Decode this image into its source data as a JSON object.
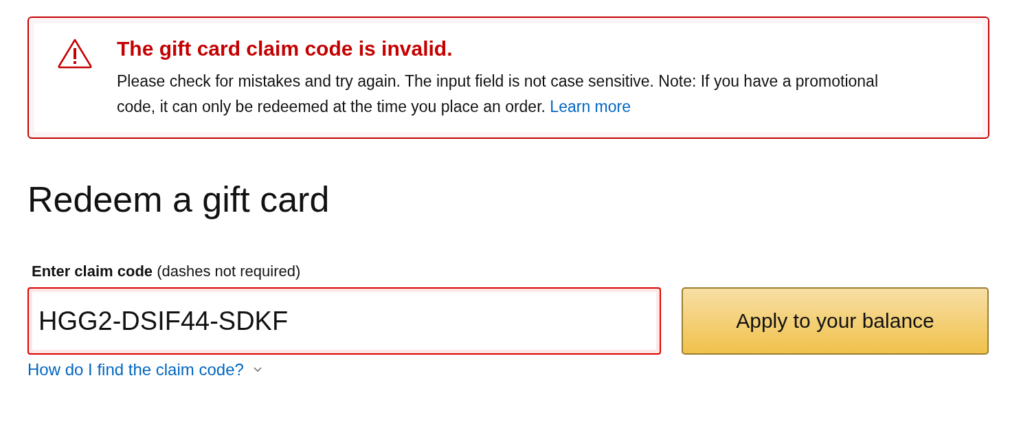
{
  "alert": {
    "kind": "error",
    "title": "The gift card claim code is invalid.",
    "message": "Please check for mistakes and try again. The input field is not case sensitive. Note: If you have a promotional code, it can only be redeemed at the time you place an order.",
    "link": "Learn more"
  },
  "heading": "Redeem a gift card",
  "claim_field": {
    "label": "**Enter claim code** (dashes not required)",
    "value": "HGG2-DSIF44-SDKF",
    "invalid": true
  },
  "apply_button": "Apply to your balance",
  "help_link": {
    "label": "How do I find the claim code?",
    "expanded": false
  }
}
